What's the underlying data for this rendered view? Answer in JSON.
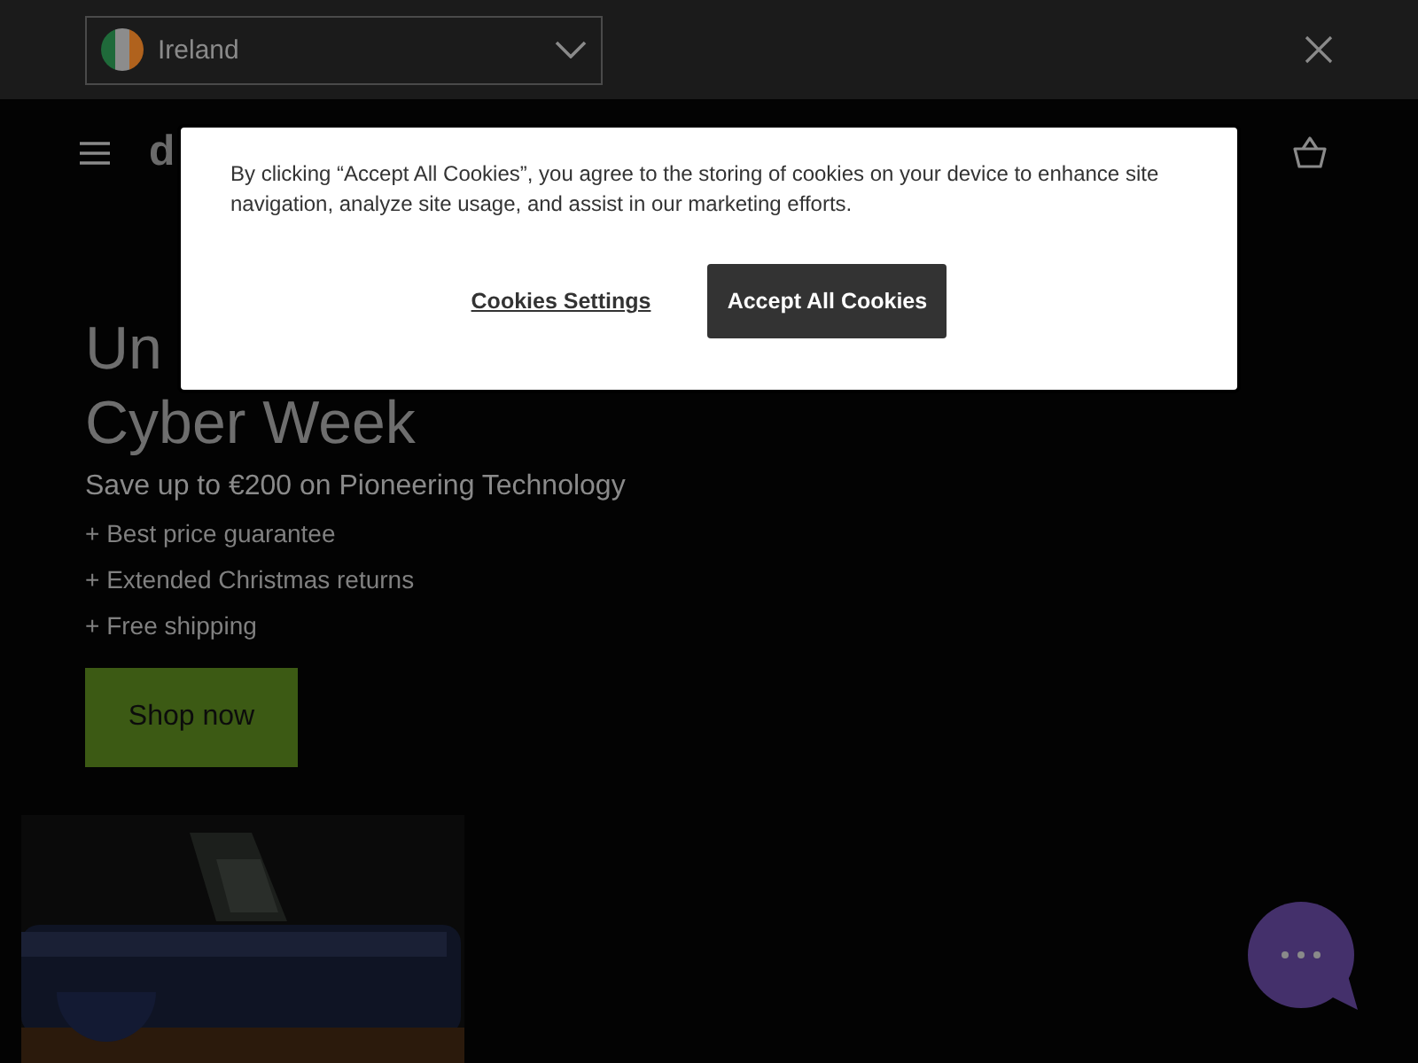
{
  "country_bar": {
    "country": "Ireland"
  },
  "header": {
    "logo": "d"
  },
  "hero": {
    "title_lines": [
      "Un",
      "Cyber Week"
    ],
    "subtitle": "Save up to €200 on Pioneering Technology",
    "benefits": [
      "+ Best price guarantee",
      "+ Extended Christmas returns",
      "+ Free shipping"
    ],
    "button": "Shop now",
    "media": {
      "kind": "picture"
    }
  },
  "cookie_banner": {
    "message": "By clicking “Accept All Cookies”, you agree to the storing of cookies on your device to enhance site navigation, analyze site usage, and assist in our marketing efforts.",
    "settings_link": "Cookies Settings",
    "accept_button": "Accept All Cookies"
  }
}
